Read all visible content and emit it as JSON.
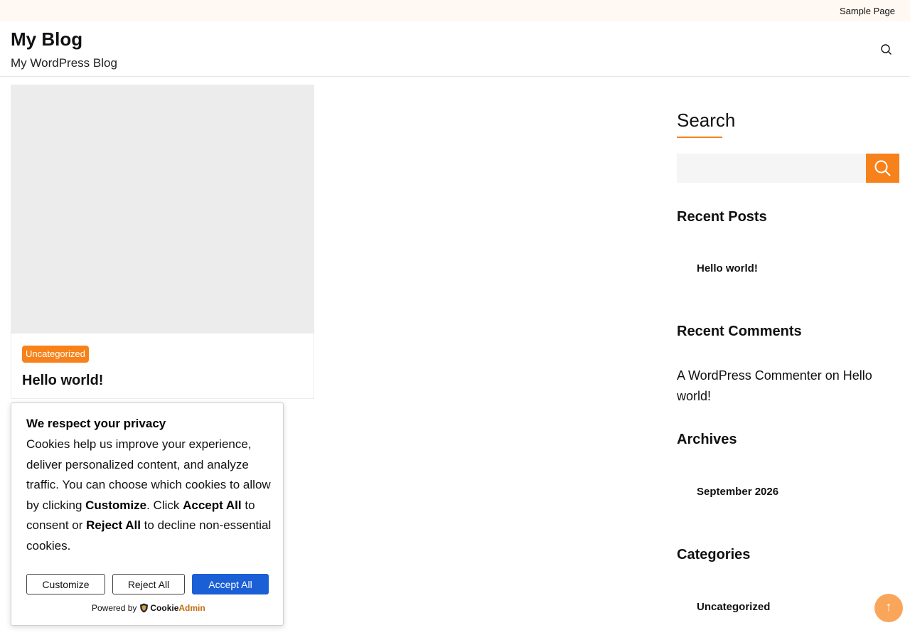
{
  "topbar": {
    "sample_page": "Sample Page"
  },
  "header": {
    "site_title": "My Blog",
    "tagline": "My WordPress Blog",
    "search_icon": "search-icon"
  },
  "post": {
    "category": "Uncategorized",
    "title": "Hello world!"
  },
  "sidebar": {
    "search": {
      "heading": "Search",
      "input_value": "",
      "button_icon": "search-icon"
    },
    "recent_posts": {
      "heading": "Recent Posts",
      "items": [
        "Hello world!"
      ]
    },
    "recent_comments": {
      "heading": "Recent Comments",
      "author": "A WordPress Commenter",
      "on": "on",
      "post": "Hello world!"
    },
    "archives": {
      "heading": "Archives",
      "items": [
        "September 2026"
      ]
    },
    "categories": {
      "heading": "Categories",
      "items": [
        "Uncategorized"
      ]
    }
  },
  "cookie": {
    "title": "We respect your privacy",
    "body_1": "Cookies help us improve your experience, deliver personalized content, and analyze traffic. You can choose which cookies to allow by clicking ",
    "customize_bold": "Customize",
    "body_2": ". Click ",
    "accept_bold": "Accept All",
    "body_3": " to consent or ",
    "reject_bold": "Reject All",
    "body_4": " to decline non-essential cookies.",
    "buttons": {
      "customize": "Customize",
      "reject": "Reject All",
      "accept": "Accept All"
    },
    "powered_by": "Powered by",
    "brand_part1": "Cookie",
    "brand_part2": "Admin"
  },
  "scroll_top": {
    "icon": "arrow-up-icon",
    "glyph": "↑"
  },
  "colors": {
    "accent": "#f7821b",
    "accept_button": "#1a5fd6",
    "scroll_top": "#f9a55a",
    "topbar_bg": "#fff8f3"
  }
}
